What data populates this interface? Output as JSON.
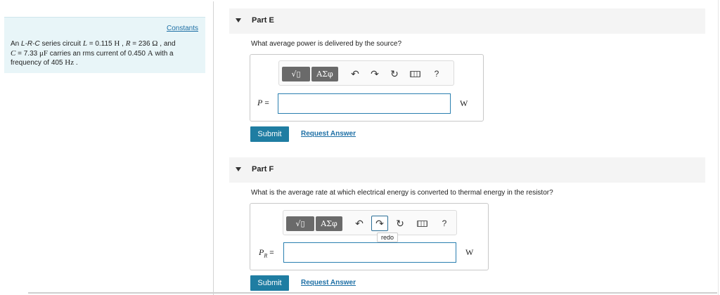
{
  "constants": {
    "link_label": "Constants",
    "problem": {
      "t1": "An ",
      "circuit_type": "L-R-C",
      "t2": " series circuit ",
      "L_sym": "L",
      "t3": " = 0.115 ",
      "L_unit": "H",
      "t4": " , ",
      "R_sym": "R",
      "t5": " = 236 ",
      "R_unit": "Ω",
      "t6": " , and",
      "C_sym": "C",
      "t7": " = 7.33 ",
      "C_unit": "μF",
      "t8": " carries an rms current of 0.450 ",
      "I_unit": "A",
      "t9": " with a frequency of 405 ",
      "f_unit": "Hz",
      "t10": " ."
    }
  },
  "parts": [
    {
      "title": "Part E",
      "question": "What average power is delivered by the source?",
      "toolbar": {
        "template_label": "√▯",
        "symbols_label": "ΑΣφ",
        "undo_icon": "↶",
        "redo_icon": "↷",
        "reset_icon": "↻",
        "help_label": "?"
      },
      "var_symbol": "P",
      "var_sub": "",
      "eq": "=",
      "input_value": "",
      "unit": "W",
      "submit_label": "Submit",
      "request_label": "Request Answer"
    },
    {
      "title": "Part F",
      "question": "What is the average rate at which electrical energy is converted to thermal energy in the resistor?",
      "toolbar": {
        "template_label": "√▯",
        "symbols_label": "ΑΣφ",
        "undo_icon": "↶",
        "redo_icon": "↷",
        "reset_icon": "↻",
        "help_label": "?",
        "tooltip": "redo"
      },
      "var_symbol": "P",
      "var_sub": "R",
      "eq": "=",
      "input_value": "",
      "unit": "W",
      "submit_label": "Submit",
      "request_label": "Request Answer"
    }
  ],
  "colors": {
    "accent": "#1f7da2",
    "link": "#1d6fa5",
    "panel_bg": "#e8f5f8",
    "header_bg": "#f4f4f4"
  }
}
